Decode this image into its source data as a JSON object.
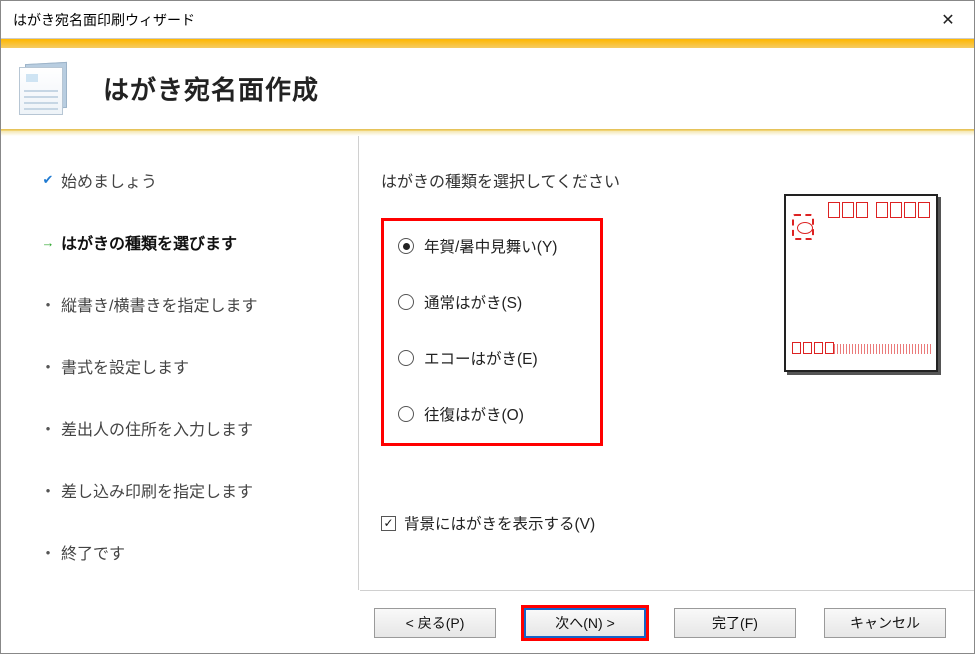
{
  "title": "はがき宛名面印刷ウィザード",
  "header": {
    "heading": "はがき宛名面作成"
  },
  "steps": {
    "items": [
      {
        "label": "始めましょう",
        "state": "done"
      },
      {
        "label": "はがきの種類を選びます",
        "state": "active"
      },
      {
        "label": "縦書き/横書きを指定します",
        "state": "pending"
      },
      {
        "label": "書式を設定します",
        "state": "pending"
      },
      {
        "label": "差出人の住所を入力します",
        "state": "pending"
      },
      {
        "label": "差し込み印刷を指定します",
        "state": "pending"
      },
      {
        "label": "終了です",
        "state": "pending"
      }
    ]
  },
  "main": {
    "prompt": "はがきの種類を選択してください",
    "options": [
      {
        "label": "年賀/暑中見舞い(Y)",
        "selected": true
      },
      {
        "label": "通常はがき(S)",
        "selected": false
      },
      {
        "label": "エコーはがき(E)",
        "selected": false
      },
      {
        "label": "往復はがき(O)",
        "selected": false
      }
    ],
    "show_background": {
      "label": "背景にはがきを表示する(V)",
      "checked": true
    }
  },
  "buttons": {
    "back": "< 戻る(P)",
    "next": "次へ(N) >",
    "finish": "完了(F)",
    "cancel": "キャンセル"
  }
}
